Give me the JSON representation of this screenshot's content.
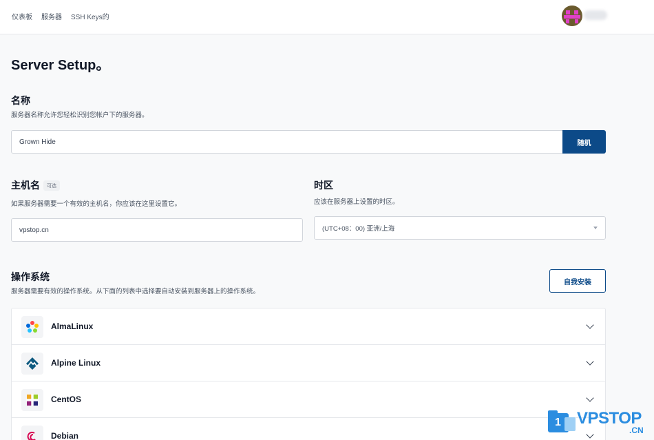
{
  "nav": {
    "items": [
      "仪表板",
      "服务器",
      "SSH Keys的"
    ]
  },
  "page": {
    "title": "Server Setup。"
  },
  "name_section": {
    "title": "名称",
    "desc": "服务器名称允许您轻松识别您帐户下的服务器。",
    "value": "Grown Hide",
    "random_label": "随机"
  },
  "hostname_section": {
    "title": "主机名",
    "optional": "可选",
    "desc": "如果服务器需要一个有效的主机名，你应该在这里设置它。",
    "value": "vpstop.cn"
  },
  "timezone_section": {
    "title": "时区",
    "desc": "应该在服务器上设置的时区。",
    "selected": "(UTC+08：00) 亚洲/上海"
  },
  "os_section": {
    "title": "操作系统",
    "desc": "服务器需要有效的操作系统。从下面的列表中选择要自动安装到服务器上的操作系统。",
    "self_install_label": "自我安装",
    "items": [
      {
        "name": "AlmaLinux",
        "icon": "almalinux-icon"
      },
      {
        "name": "Alpine Linux",
        "icon": "alpine-icon"
      },
      {
        "name": "CentOS",
        "icon": "centos-icon"
      },
      {
        "name": "Debian",
        "icon": "debian-icon"
      }
    ]
  },
  "watermark": {
    "text": "VPSTOP",
    "suffix": ".CN",
    "badge": "1"
  },
  "colors": {
    "primary": "#0c4a88",
    "watermark": "#2b8de0"
  }
}
